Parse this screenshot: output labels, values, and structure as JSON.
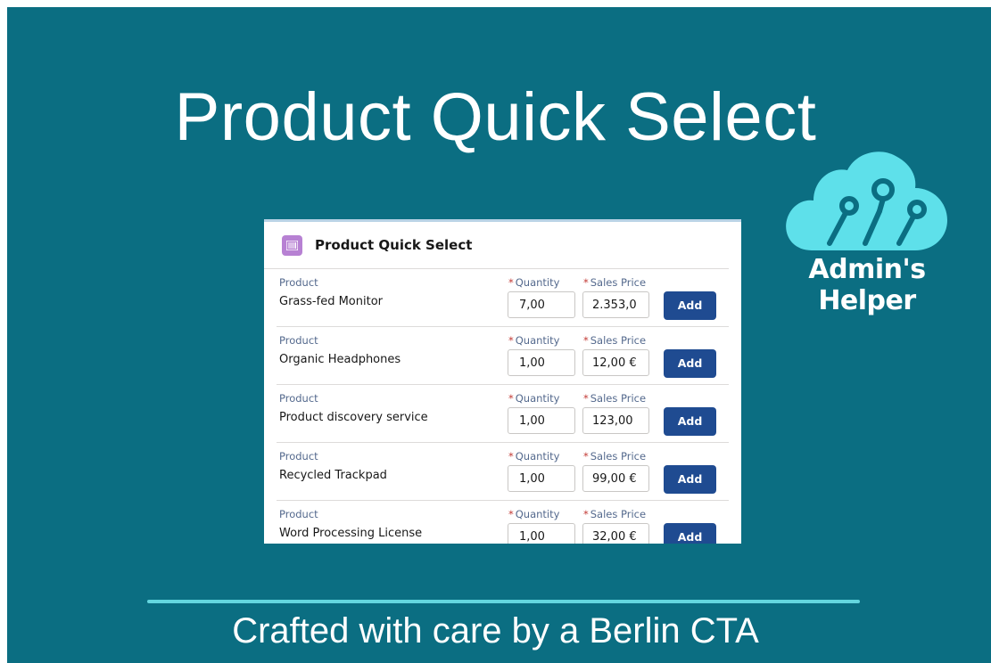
{
  "banner": {
    "title": "Product Quick Select",
    "footer": "Crafted with care by a Berlin CTA",
    "colors": {
      "background": "#0b6e82",
      "accent": "#64d6df",
      "button": "#1f4b91"
    }
  },
  "logo": {
    "text": "Admin's Helper",
    "icon": "cloud-wrench-icon"
  },
  "card": {
    "title": "Product Quick Select",
    "icon": "barcode-icon",
    "labels": {
      "product": "Product",
      "quantity": "Quantity",
      "sales_price": "Sales Price",
      "required_marker": "*",
      "add": "Add"
    },
    "rows": [
      {
        "product": "Grass-fed Monitor",
        "quantity": "7,00",
        "sales_price": "2.353,0"
      },
      {
        "product": "Organic Headphones",
        "quantity": "1,00",
        "sales_price": "12,00 €"
      },
      {
        "product": "Product discovery service",
        "quantity": "1,00",
        "sales_price": "123,00"
      },
      {
        "product": "Recycled Trackpad",
        "quantity": "1,00",
        "sales_price": "99,00 €"
      },
      {
        "product": "Word Processing License",
        "quantity": "1,00",
        "sales_price": "32,00 €"
      }
    ]
  }
}
